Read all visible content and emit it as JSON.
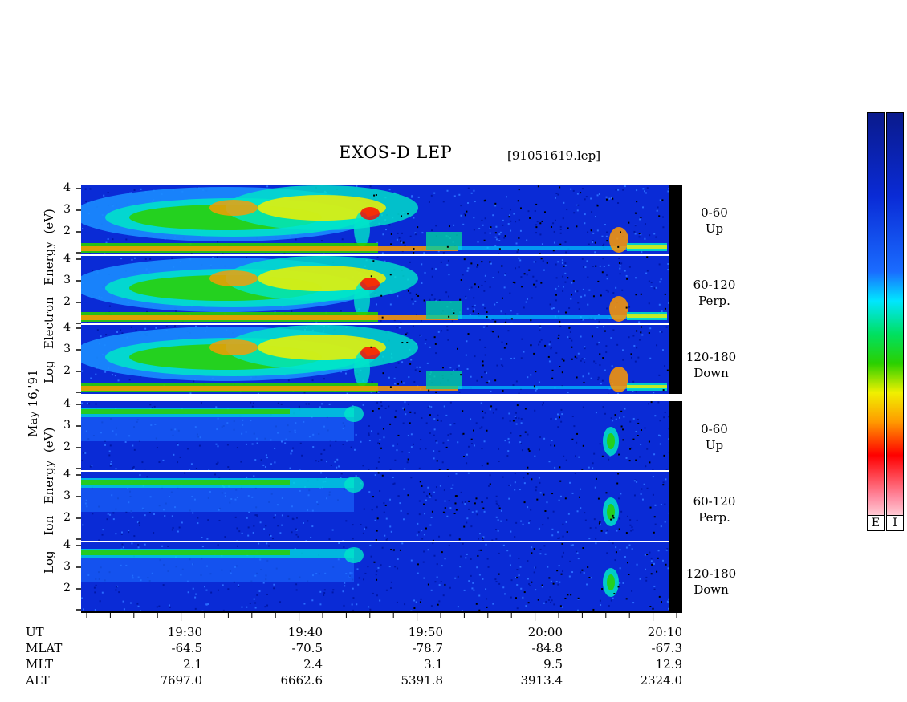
{
  "header": {
    "title": "EXOS-D LEP",
    "file": "[91051619.lep]"
  },
  "date_label": "May 16,'91",
  "electron_ylabel": [
    "Log",
    "Electron",
    "Energy",
    "(eV)"
  ],
  "ion_ylabel": [
    "Log",
    "Ion",
    "Energy",
    "(eV)"
  ],
  "ytick_labels": [
    "4",
    "3",
    "2"
  ],
  "pitch_labels": [
    {
      "range": "0-60",
      "dir": "Up"
    },
    {
      "range": "60-120",
      "dir": "Perp."
    },
    {
      "range": "120-180",
      "dir": "Down"
    },
    {
      "range": "0-60",
      "dir": "Up"
    },
    {
      "range": "60-120",
      "dir": "Perp."
    },
    {
      "range": "120-180",
      "dir": "Down"
    }
  ],
  "colorbar": {
    "labels": [
      "E",
      "I"
    ]
  },
  "colors": {
    "background": "#0a2bd6"
  },
  "orbit_table": {
    "row_labels": [
      "UT",
      "MLAT",
      "MLT",
      "ALT"
    ],
    "columns": [
      {
        "UT": "19:30",
        "MLAT": "-64.5",
        "MLT": "2.1",
        "ALT": "7697.0"
      },
      {
        "UT": "19:40",
        "MLAT": "-70.5",
        "MLT": "2.4",
        "ALT": "6662.6"
      },
      {
        "UT": "19:50",
        "MLAT": "-78.7",
        "MLT": "3.1",
        "ALT": "5391.8"
      },
      {
        "UT": "20:00",
        "MLAT": "-84.8",
        "MLT": "9.5",
        "ALT": "3913.4"
      },
      {
        "UT": "20:10",
        "MLAT": "-67.3",
        "MLT": "12.9",
        "ALT": "2324.0"
      }
    ]
  },
  "chart_data": {
    "type": "heatmap",
    "title": "EXOS-D LEP",
    "ylabel": "Log Energy (eV)",
    "ylim": [
      1,
      4
    ],
    "xlim": [
      "19:22",
      "20:11"
    ],
    "panels": [
      {
        "species": "Electron",
        "pitch": "0-60 Up"
      },
      {
        "species": "Electron",
        "pitch": "60-120 Perp."
      },
      {
        "species": "Electron",
        "pitch": "120-180 Down"
      },
      {
        "species": "Ion",
        "pitch": "0-60 Up"
      },
      {
        "species": "Ion",
        "pitch": "60-120 Perp."
      },
      {
        "species": "Ion",
        "pitch": "120-180 Down"
      }
    ]
  }
}
